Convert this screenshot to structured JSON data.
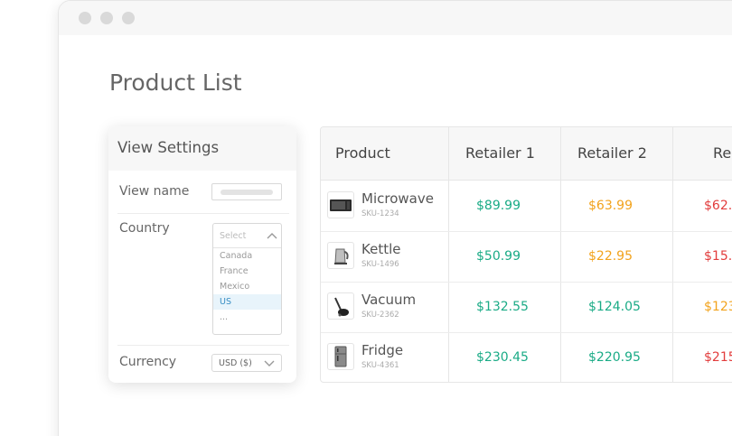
{
  "page": {
    "title": "Product List"
  },
  "colors": {
    "green": "#1aab86",
    "orange": "#f2a31d",
    "red": "#e23c3c"
  },
  "view_settings": {
    "title": "View Settings",
    "view_name_label": "View name",
    "country_label": "Country",
    "country_placeholder": "Select",
    "country_options": [
      "Canada",
      "France",
      "Mexico",
      "US",
      "..."
    ],
    "country_selected": "US",
    "currency_label": "Currency",
    "currency_value": "USD ($)"
  },
  "table": {
    "headers": [
      "Product",
      "Retailer 1",
      "Retailer 2",
      "Re"
    ],
    "rows": [
      {
        "icon": "microwave-icon",
        "name": "Microwave",
        "sku": "SKU-1234",
        "prices": [
          {
            "text": "$89.99",
            "color": "green"
          },
          {
            "text": "$63.99",
            "color": "orange"
          },
          {
            "text": "$62.",
            "color": "red"
          }
        ]
      },
      {
        "icon": "kettle-icon",
        "name": "Kettle",
        "sku": "SKU-1496",
        "prices": [
          {
            "text": "$50.99",
            "color": "green"
          },
          {
            "text": "$22.95",
            "color": "orange"
          },
          {
            "text": "$15.",
            "color": "red"
          }
        ]
      },
      {
        "icon": "vacuum-icon",
        "name": "Vacuum",
        "sku": "SKU-2362",
        "prices": [
          {
            "text": "$132.55",
            "color": "green"
          },
          {
            "text": "$124.05",
            "color": "green"
          },
          {
            "text": "$123",
            "color": "orange"
          }
        ]
      },
      {
        "icon": "fridge-icon",
        "name": "Fridge",
        "sku": "SKU-4361",
        "prices": [
          {
            "text": "$230.45",
            "color": "green"
          },
          {
            "text": "$220.95",
            "color": "green"
          },
          {
            "text": "$215",
            "color": "red"
          }
        ]
      }
    ]
  }
}
